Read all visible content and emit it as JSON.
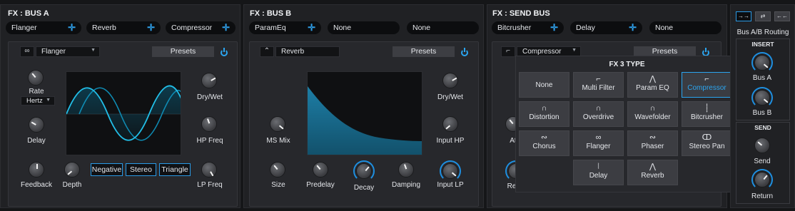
{
  "bus_a": {
    "title": "FX : BUS A",
    "slots": [
      "Flanger",
      "Reverb",
      "Compressor"
    ],
    "effect": {
      "icon": "∞",
      "name": "Flanger",
      "presets": "Presets"
    },
    "rate": {
      "label": "Rate",
      "unit": "Hertz"
    },
    "knobs": {
      "delay": "Delay",
      "feedback": "Feedback",
      "depth": "Depth",
      "drywet": "Dry/Wet",
      "hpfreq": "HP Freq",
      "lpfreq": "LP Freq"
    },
    "toggles": [
      "Negative",
      "Stereo",
      "Triangle"
    ]
  },
  "bus_b": {
    "title": "FX : BUS B",
    "slots": [
      "ParamEq",
      "None",
      "None"
    ],
    "effect": {
      "icon": "⌃",
      "name": "Reverb",
      "presets": "Presets"
    },
    "knobs": {
      "msmix": "MS Mix",
      "size": "Size",
      "predelay": "Predelay",
      "decay": "Decay",
      "damping": "Damping",
      "drywet": "Dry/Wet",
      "inputhp": "Input HP",
      "inputlp": "Input LP"
    }
  },
  "send_bus": {
    "title": "FX : SEND BUS",
    "slots": [
      "Bitcrusher",
      "Delay",
      "None"
    ],
    "effect": {
      "icon": "⌐",
      "name": "Compressor",
      "presets": "Presets"
    },
    "partial_labels": [
      "At",
      "Re"
    ]
  },
  "fx_type_popup": {
    "title": "FX 3 TYPE",
    "options": [
      {
        "label": "None",
        "icon": ""
      },
      {
        "label": "Multi Filter",
        "icon": "⌐"
      },
      {
        "label": "Param EQ",
        "icon": "⋀"
      },
      {
        "label": "Compressor",
        "icon": "⌐",
        "selected": true
      },
      {
        "label": "Distortion",
        "icon": "∩"
      },
      {
        "label": "Overdrive",
        "icon": "∩"
      },
      {
        "label": "Wavefolder",
        "icon": "∩"
      },
      {
        "label": "Bitcrusher",
        "icon": "⸽"
      },
      {
        "label": "Chorus",
        "icon": "∾"
      },
      {
        "label": "Flanger",
        "icon": "∞"
      },
      {
        "label": "Phaser",
        "icon": "∾"
      },
      {
        "label": "Stereo Pan",
        "icon": "ↀ"
      },
      {
        "label": "Delay",
        "icon": "⦚"
      },
      {
        "label": "Reverb",
        "icon": "⋀"
      }
    ]
  },
  "routing": {
    "buttons": [
      "→→",
      "⇄",
      "←←"
    ],
    "label": "Bus A/B Routing",
    "insert": {
      "title": "INSERT",
      "bus_a": "Bus A",
      "bus_b": "Bus B"
    },
    "send": {
      "title": "SEND",
      "send": "Send",
      "return": "Return"
    }
  },
  "colors": {
    "accent": "#2ba5f0",
    "background": "#151618",
    "panel": "#202124"
  }
}
